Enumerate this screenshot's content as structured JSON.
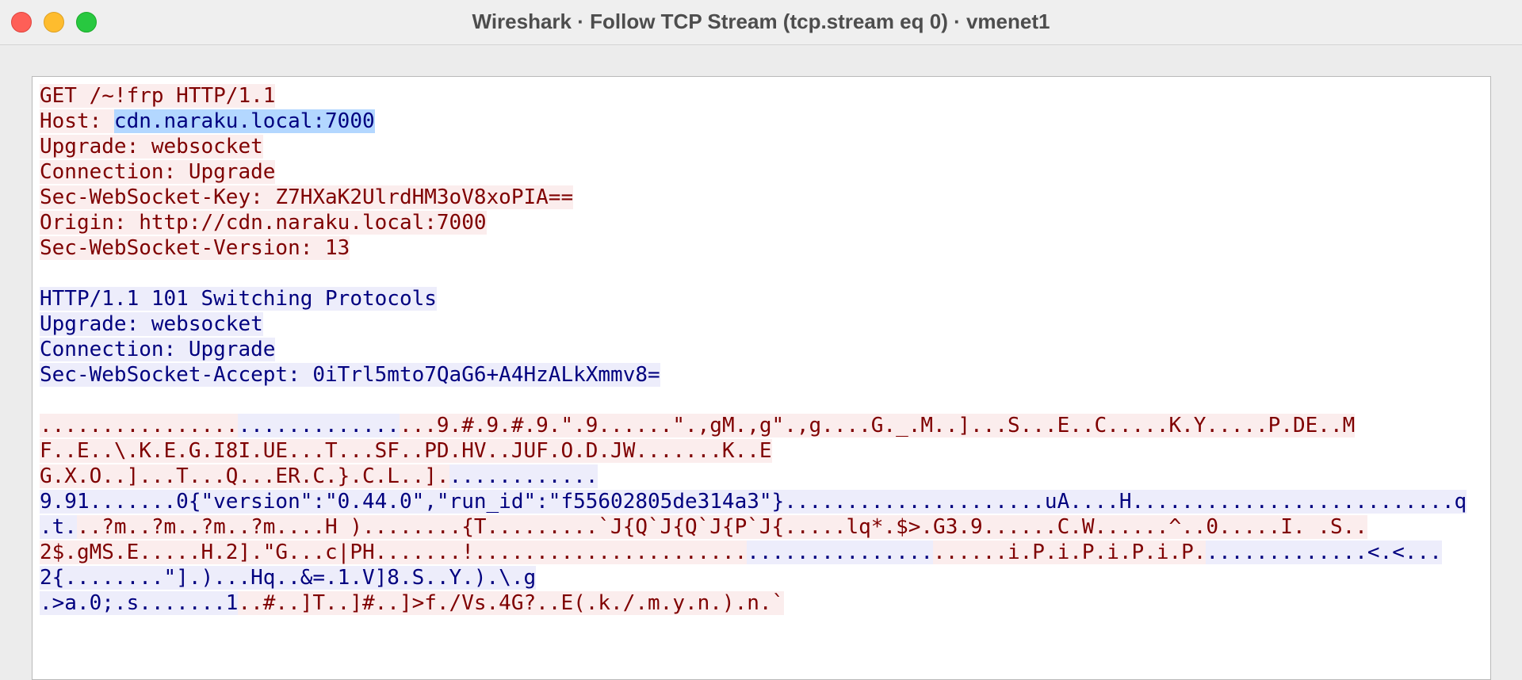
{
  "window": {
    "title": "Wireshark · Follow TCP Stream (tcp.stream eq 0) · vmenet1"
  },
  "colors": {
    "client_bg": "#fbeded",
    "client_fg": "#7f0000",
    "server_bg": "#ededfb",
    "server_fg": "#00007f",
    "selection_bg": "#b3d7ff"
  },
  "stream": {
    "lines": [
      [
        {
          "t": "GET /~!frp HTTP/1.1",
          "d": "c"
        }
      ],
      [
        {
          "t": "Host: ",
          "d": "c"
        },
        {
          "t": "cdn.naraku.local:7000",
          "d": "sel"
        }
      ],
      [
        {
          "t": "Upgrade: websocket",
          "d": "c"
        }
      ],
      [
        {
          "t": "Connection: Upgrade",
          "d": "c"
        }
      ],
      [
        {
          "t": "Sec-WebSocket-Key: Z7HXaK2UlrdHM3oV8xoPIA==",
          "d": "c"
        }
      ],
      [
        {
          "t": "Origin: http://cdn.naraku.local:7000",
          "d": "c"
        }
      ],
      [
        {
          "t": "Sec-WebSocket-Version: 13",
          "d": "c"
        }
      ],
      [],
      [
        {
          "t": "HTTP/1.1 101 Switching Protocols",
          "d": "s"
        }
      ],
      [
        {
          "t": "Upgrade: websocket",
          "d": "s"
        }
      ],
      [
        {
          "t": "Connection: Upgrade",
          "d": "s"
        }
      ],
      [
        {
          "t": "Sec-WebSocket-Accept: 0iTrl5mto7QaG6+A4HzALkXmmv8=",
          "d": "s"
        }
      ],
      [],
      [
        {
          "t": "................",
          "d": "c"
        },
        {
          "t": ".............",
          "d": "s"
        },
        {
          "t": "...9.#.9.#.9.\".9......\".,gM.,g\".,g....G._.M..]...S...E..C.....K.Y.....P.DE..M",
          "d": "c"
        }
      ],
      [
        {
          "t": "F..E..\\.K.E.G.I8I.UE...T...SF..PD.HV..JUF.O.D.JW.......K..E",
          "d": "c"
        }
      ],
      [
        {
          "t": "G.X.O..]...T...Q...ER.C.}.C.L..].",
          "d": "c"
        },
        {
          "t": "............",
          "d": "s"
        }
      ],
      [
        {
          "t": "9.91.......0{\"version\":\"0.44.0\",\"run_id\":\"f55602805de314a3\"}.....................uA....H..........................q",
          "d": "s"
        }
      ],
      [
        {
          "t": ".t.",
          "d": "s"
        },
        {
          "t": "..?m..?m..?m..?m....H )........{T.........`J{Q`J{Q`J{P`J{.....lq*.$>.G3.9......C.W......^..0.....I. .S..",
          "d": "c"
        }
      ],
      [
        {
          "t": "2$.gMS.E.....H.2].\"G...c|PH.......!......................",
          "d": "c"
        },
        {
          "t": "...............",
          "d": "s"
        },
        {
          "t": "......i.P.i.P.i.P.i.P.",
          "d": "c"
        },
        {
          "t": ".............<.<...",
          "d": "s"
        }
      ],
      [
        {
          "t": "2{........\"].)...Hq..&=.1.V]8.S..Y.).\\.g",
          "d": "s"
        }
      ],
      [
        {
          "t": ".>a.0;.s.......1",
          "d": "s"
        },
        {
          "t": "..#..]T..]#..]>f./Vs.4G?..E(.k./.m.y.n.).n.`",
          "d": "c"
        }
      ]
    ]
  }
}
